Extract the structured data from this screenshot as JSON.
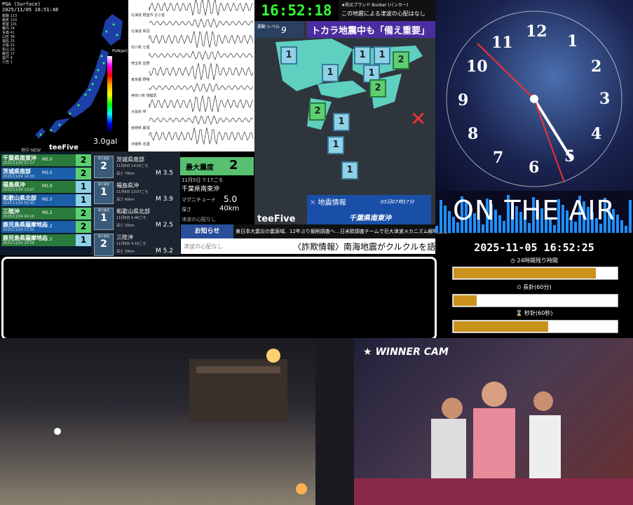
{
  "pga": {
    "header": "PGA (Surface)",
    "timestamp": "2025/11/05 16:51:48",
    "scale_label": "PGA[gal]",
    "gal": "3.0gal",
    "stations": [
      "釧路 113",
      "網走 110",
      "根室 101",
      "稚内 74",
      "青森 41",
      "山形 36",
      "福島 31",
      "大阪 21",
      "松山 21",
      "鹿児 17",
      "室戸 4",
      "小笠 1"
    ]
  },
  "seismograph": {
    "stations": [
      "北海道 根室市 古小室",
      "北海道 新冠",
      "石川県 七尾",
      "埼玉県 皆野",
      "東京都 野崎",
      "神奈川県 相模原",
      "大阪府 堺",
      "宮崎県 都城",
      "沖縄県 名護"
    ]
  },
  "quake_list": {
    "header_label": "最大震度",
    "logo": "teeFive",
    "sub": "地中 NEW",
    "rows": [
      {
        "name": "千葉県南東沖",
        "meta": "2025/11/05 07:17",
        "mag": "M5.0",
        "intensity": "2",
        "color": "#5ccf71"
      },
      {
        "name": "茨城県南部",
        "meta": "2025/11/04 14:00",
        "mag": "M3.5",
        "intensity": "2",
        "color": "#5ccf71"
      },
      {
        "name": "福島県沖",
        "meta": "2025/11/04 13:07",
        "mag": "M3.9",
        "intensity": "1",
        "color": "#8fd2e8"
      },
      {
        "name": "和歌山県北部",
        "meta": "2025/11/04 05:40",
        "mag": "M2.5",
        "intensity": "1",
        "color": "#8fd2e8"
      },
      {
        "name": "三陸沖",
        "meta": "2025/11/04 04:16",
        "mag": "M5.2",
        "intensity": "2",
        "color": "#5ccf71"
      },
      {
        "name": "鹿児島県薩摩地方",
        "meta": "2025/11/03 21:01",
        "mag": "M2.2",
        "intensity": "2",
        "color": "#5ccf71"
      },
      {
        "name": "鹿児島県薩摩地方",
        "meta": "2025/11/03 20:09",
        "mag": "M1.5",
        "intensity": "1",
        "color": "#8fd2e8"
      }
    ]
  },
  "quake_cards": [
    {
      "label": "最大震度",
      "intensity": "2",
      "name": "茨城県南部",
      "time": "11月6日 14:00ごろ",
      "depth": "深さ 70km",
      "mag": "M 3.5"
    },
    {
      "label": "最大震度",
      "intensity": "1",
      "name": "福島県沖",
      "time": "11月6日 13:07ごろ",
      "depth": "深さ 40km",
      "mag": "M 3.9"
    },
    {
      "label": "最大震度",
      "intensity": "1",
      "name": "和歌山県北部",
      "time": "11月6日 5:40ごろ",
      "depth": "深さ 10km",
      "mag": "M 2.5"
    },
    {
      "label": "最大震度",
      "intensity": "2",
      "name": "三陸沖",
      "time": "11月6日 4:16ごろ",
      "depth": "深さ 10km",
      "mag": "M 5.2"
    }
  ],
  "max_intensity": {
    "label": "最大震度",
    "value": "2",
    "time": "11月5日 7:17ごろ",
    "location": "千葉県南東沖",
    "mag_label": "マグニチュード",
    "mag": "5.0",
    "depth_label": "深さ",
    "depth": "40km",
    "tsunami": "津波の心配なし"
  },
  "top_clock": "16:52:18",
  "top_message": {
    "line1": "★防災ブランド Bunker (バンカー)",
    "line2": "この地震による津波の心配はなし"
  },
  "level": {
    "label": "震動 レベル",
    "value": "9"
  },
  "headline": "トカラ地震中も「備え重要」",
  "map_intensities": [
    "1",
    "1",
    "1",
    "1",
    "2",
    "1",
    "2",
    "2",
    "1",
    "1",
    "1"
  ],
  "map_logo": "teeFive",
  "quake_info": {
    "title": "地震情報",
    "time": "05日07時17分",
    "location": "千葉県南東沖"
  },
  "notice": {
    "label": "お知らせ",
    "text": "東日本大震災の震源域、12年ぶり掘削調査へ…日米欧調査チームで巨大津波メカニズム解明目指す"
  },
  "ticker": "〈詐欺情報〉南海地震がクルクルを語っ",
  "ticker_faint": "津波の心配なし",
  "clock_numbers": [
    "12",
    "1",
    "2",
    "3",
    "4",
    "5",
    "6",
    "7",
    "8",
    "9",
    "10",
    "11"
  ],
  "on_air": "ON THE AIR",
  "datetime": "2025-11-05 16:52:25",
  "progress": [
    {
      "label": "◷ 24時間残り時間",
      "fraction": 0.87
    },
    {
      "label": "⏲ 長針(60分)",
      "fraction": 0.14
    },
    {
      "label": "⌛ 秒針(60秒)",
      "fraction": 0.58
    }
  ],
  "winner_cam": "WINNER CAM"
}
